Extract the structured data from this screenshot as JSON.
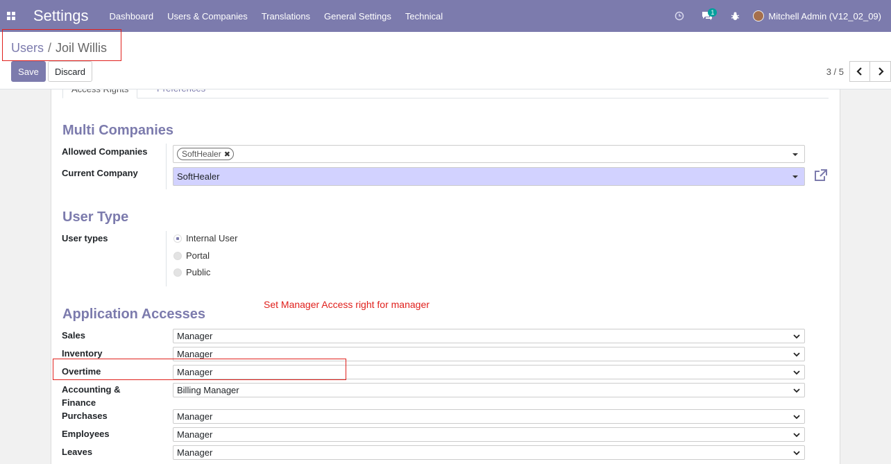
{
  "navbar": {
    "app_title": "Settings",
    "menu": [
      "Dashboard",
      "Users & Companies",
      "Translations",
      "General Settings",
      "Technical"
    ],
    "messages_count": "1",
    "user_label": "Mitchell Admin (V12_02_09)"
  },
  "breadcrumb": {
    "parent": "Users",
    "separator": "/",
    "current": "Joil Willis"
  },
  "buttons": {
    "save": "Save",
    "discard": "Discard"
  },
  "pager": {
    "value": "3 / 5"
  },
  "tabs": [
    "Access Rights",
    "Preferences"
  ],
  "multi_companies": {
    "title": "Multi Companies",
    "allowed_label": "Allowed Companies",
    "allowed_tags": [
      "SoftHealer"
    ],
    "current_label": "Current Company",
    "current_value": "SoftHealer"
  },
  "user_type": {
    "title": "User Type",
    "label": "User types",
    "options": [
      "Internal User",
      "Portal",
      "Public"
    ],
    "selected": "Internal User"
  },
  "annotation": "Set Manager Access right for manager",
  "application_accesses": {
    "title": "Application Accesses",
    "rows": [
      {
        "label": "Sales",
        "value": "Manager"
      },
      {
        "label": "Inventory",
        "value": "Manager"
      },
      {
        "label": "Overtime",
        "value": "Manager"
      },
      {
        "label": "Accounting & Finance",
        "value": "Billing Manager"
      },
      {
        "label": "Purchases",
        "value": "Manager"
      },
      {
        "label": "Employees",
        "value": "Manager"
      },
      {
        "label": "Leaves",
        "value": "Manager"
      }
    ]
  },
  "colors": {
    "brand": "#7c7bad",
    "highlight_red": "#e0201c",
    "many2one_bg": "#d2d2ff"
  }
}
